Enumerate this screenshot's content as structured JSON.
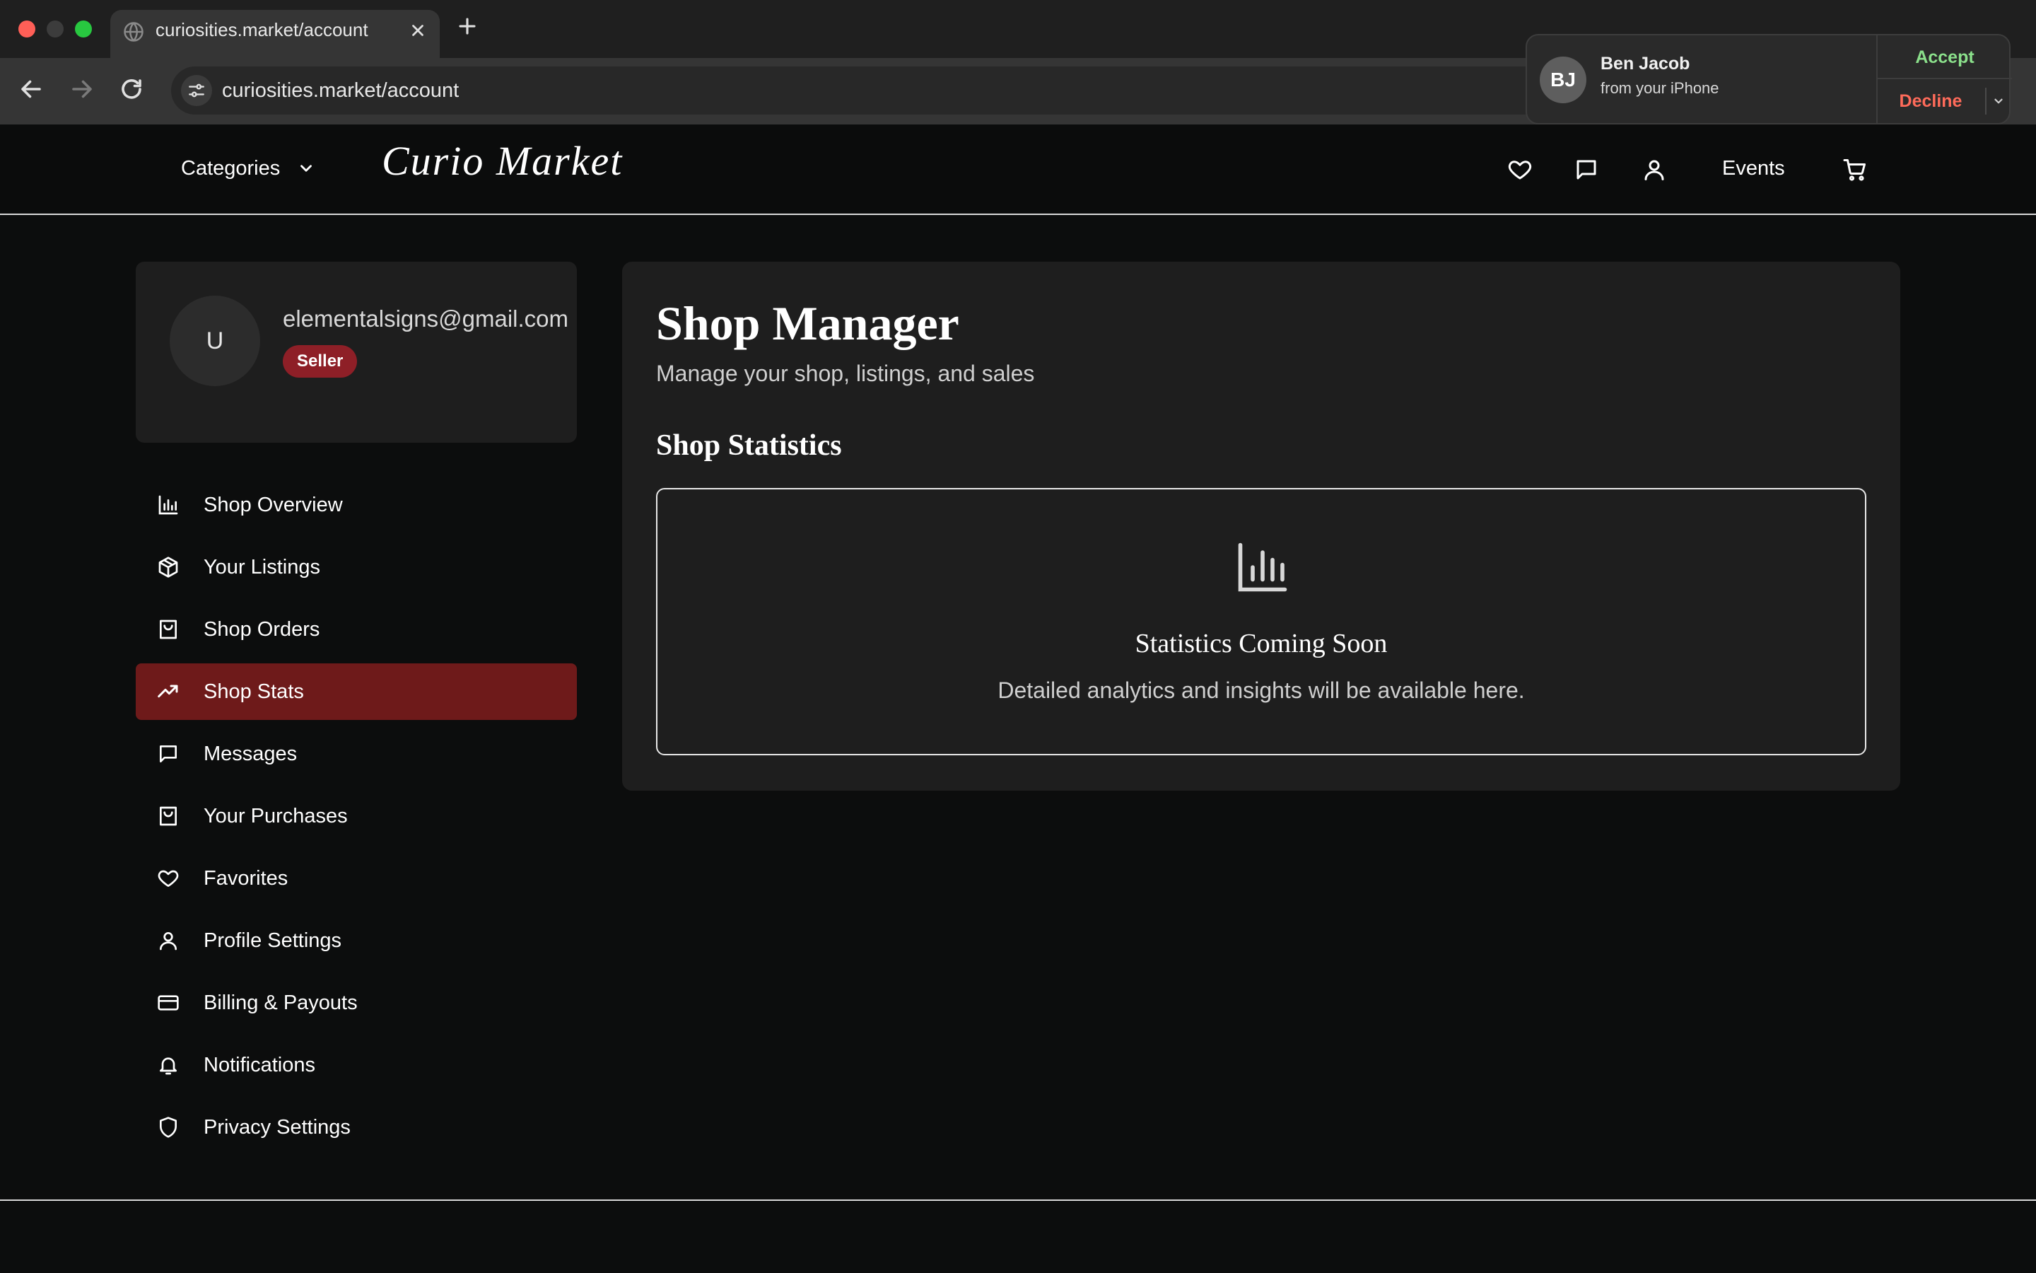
{
  "browser": {
    "tab_title": "curiosities.market/account",
    "url": "curiosities.market/account"
  },
  "notification": {
    "initials": "BJ",
    "name": "Ben Jacob",
    "subtitle": "from your iPhone",
    "accept_label": "Accept",
    "decline_label": "Decline"
  },
  "header": {
    "categories_label": "Categories",
    "logo": "Curio Market",
    "events_label": "Events"
  },
  "profile": {
    "avatar_initial": "U",
    "email": "elementalsigns@gmail.com",
    "badge": "Seller"
  },
  "sidebar": {
    "items": [
      {
        "label": "Shop Overview",
        "icon": "bar-chart-icon"
      },
      {
        "label": "Your Listings",
        "icon": "package-icon"
      },
      {
        "label": "Shop Orders",
        "icon": "shopping-bag-icon"
      },
      {
        "label": "Shop Stats",
        "icon": "trending-up-icon",
        "active": true
      },
      {
        "label": "Messages",
        "icon": "message-icon"
      },
      {
        "label": "Your Purchases",
        "icon": "shopping-bag-icon"
      },
      {
        "label": "Favorites",
        "icon": "heart-icon"
      },
      {
        "label": "Profile Settings",
        "icon": "user-icon"
      },
      {
        "label": "Billing & Payouts",
        "icon": "credit-card-icon"
      },
      {
        "label": "Notifications",
        "icon": "bell-icon"
      },
      {
        "label": "Privacy Settings",
        "icon": "shield-icon"
      }
    ]
  },
  "main": {
    "title": "Shop Manager",
    "subtitle": "Manage your shop, listings, and sales",
    "section_title": "Shop Statistics",
    "empty_heading": "Statistics Coming Soon",
    "empty_text": "Detailed analytics and insights will be available here."
  },
  "colors": {
    "accent": "#6e1a1a",
    "badge": "#8e1f27",
    "background": "#0c0d0d",
    "panel": "#1e1e1e"
  }
}
